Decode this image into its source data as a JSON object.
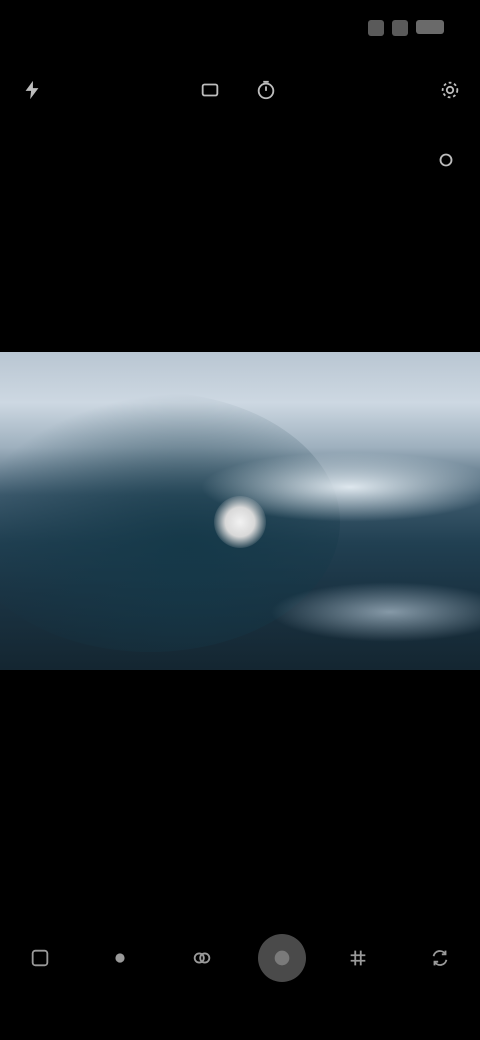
{
  "status_bar": {
    "time": ""
  },
  "sub_controls": {
    "label": ""
  },
  "modes": [
    {
      "badge": "",
      "name": ""
    },
    {
      "badge": "",
      "name": ""
    },
    {
      "badge": "",
      "name": ""
    },
    {
      "badge": "",
      "name": ""
    }
  ],
  "icons": {
    "top": [
      "flash-icon",
      "aspect-ratio-icon",
      "timer-icon",
      "settings-icon"
    ],
    "bottom": [
      "gallery-icon",
      "effects-icon",
      "filter-icon",
      "shutter-icon",
      "grid-icon",
      "switch-camera-icon"
    ]
  },
  "colors": {
    "background": "#000000",
    "shutter": "#4a4a4a",
    "focus_point": "#f2f2f2",
    "sky": "#cdd8e2",
    "sea": "#214052"
  }
}
